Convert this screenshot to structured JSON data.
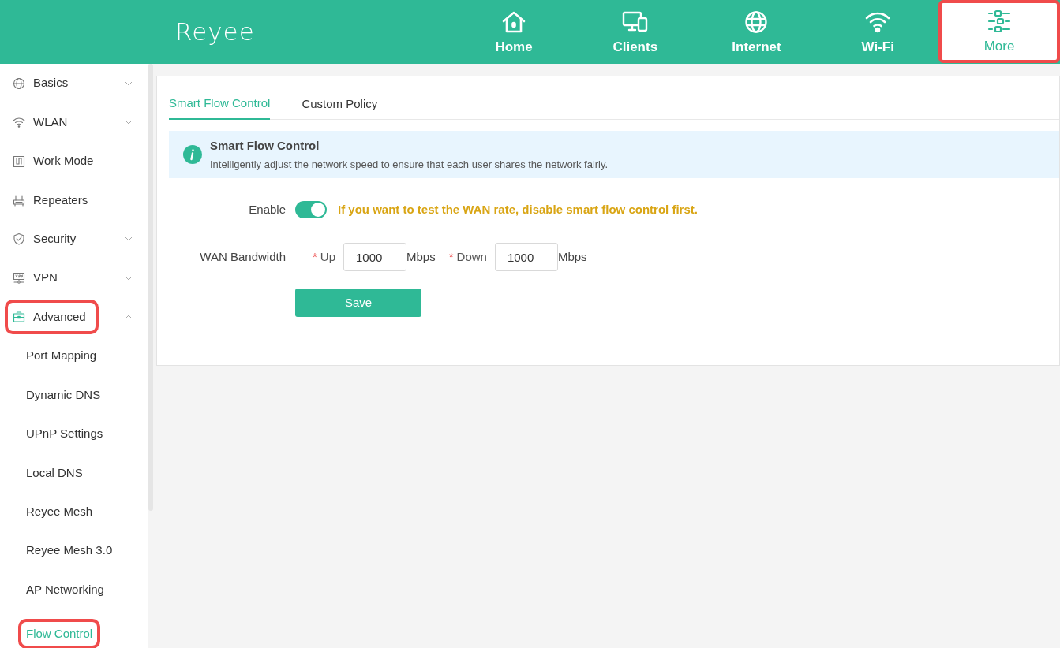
{
  "header": {
    "logo": "Reyee",
    "nav": [
      {
        "label": "Home",
        "selected": false,
        "highlighted": false
      },
      {
        "label": "Clients",
        "selected": false,
        "highlighted": false
      },
      {
        "label": "Internet",
        "selected": false,
        "highlighted": false
      },
      {
        "label": "Wi-Fi",
        "selected": false,
        "highlighted": false
      },
      {
        "label": "More",
        "selected": true,
        "highlighted": true
      }
    ]
  },
  "sidebar": {
    "items": [
      {
        "kind": "group",
        "label": "Basics",
        "expanded": false,
        "highlighted": false
      },
      {
        "kind": "group",
        "label": "WLAN",
        "expanded": false,
        "highlighted": false
      },
      {
        "kind": "link",
        "label": "Work Mode",
        "highlighted": false
      },
      {
        "kind": "link",
        "label": "Repeaters",
        "highlighted": false
      },
      {
        "kind": "group",
        "label": "Security",
        "expanded": false,
        "highlighted": false
      },
      {
        "kind": "group",
        "label": "VPN",
        "expanded": false,
        "highlighted": false
      },
      {
        "kind": "group",
        "label": "Advanced",
        "expanded": true,
        "highlighted": true,
        "children": [
          {
            "label": "Port Mapping",
            "selected": false,
            "highlighted": false
          },
          {
            "label": "Dynamic DNS",
            "selected": false,
            "highlighted": false
          },
          {
            "label": "UPnP Settings",
            "selected": false,
            "highlighted": false
          },
          {
            "label": "Local DNS",
            "selected": false,
            "highlighted": false
          },
          {
            "label": "Reyee Mesh",
            "selected": false,
            "highlighted": false
          },
          {
            "label": "Reyee Mesh 3.0",
            "selected": false,
            "highlighted": false
          },
          {
            "label": "AP Networking",
            "selected": false,
            "highlighted": false
          },
          {
            "label": "Flow Control",
            "selected": true,
            "highlighted": true
          }
        ]
      }
    ]
  },
  "tabs": [
    {
      "label": "Smart Flow Control",
      "selected": true
    },
    {
      "label": "Custom Policy",
      "selected": false
    }
  ],
  "info": {
    "title": "Smart Flow Control",
    "text": "Intelligently adjust the network speed to ensure that each user shares the network fairly."
  },
  "form": {
    "enable": {
      "label": "Enable",
      "on": true,
      "warning": "If you want to test the WAN rate, disable smart flow control first."
    },
    "bandwidth": {
      "label": "WAN Bandwidth",
      "fields": [
        {
          "required_mark": "*",
          "label": "Up",
          "value": "1000",
          "unit": "Mbps"
        },
        {
          "required_mark": "*",
          "label": "Down",
          "value": "1000",
          "unit": "Mbps"
        }
      ]
    },
    "save": "Save"
  }
}
